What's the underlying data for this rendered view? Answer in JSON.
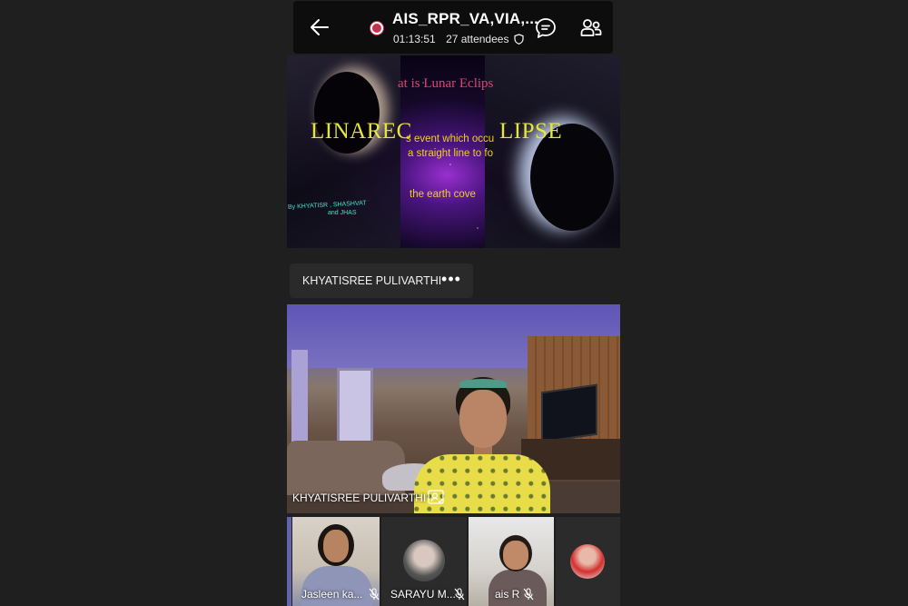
{
  "meeting": {
    "title": "AIS_RPR_VA,VIA,...",
    "duration": "01:13:51",
    "attendees": "27 attendees",
    "recording": true
  },
  "icons": {
    "back": "arrow-left-icon",
    "recording": "record-dot-icon",
    "shield": "shield-icon",
    "chat": "chat-icon",
    "participants": "people-icon",
    "more": "more-icon",
    "pin": "pin-icon",
    "mute": "mic-off-icon"
  },
  "shared_slide": {
    "title": "at is Lunar Eclips",
    "word_left": "LINAREC",
    "word_right": "LIPSE",
    "line1": "s event which occu",
    "line2": "a straight line to fo",
    "line3": "the earth cove",
    "byline": "By KHYATISR , SHASHVAT",
    "byline2": "and JHAS"
  },
  "presenter": {
    "name": "KHYATISREE PULIVARTHI",
    "more_label": "•••"
  },
  "main_video": {
    "name": "KHYATISREE PULIVARTHI"
  },
  "participants": [
    {
      "name": "Jasleen ka...",
      "muted": true
    },
    {
      "name": "SARAYU M...",
      "muted": true
    },
    {
      "name": "ais R",
      "muted": true
    },
    {
      "name": "",
      "muted": false
    }
  ],
  "colors": {
    "recording": "#c4314b",
    "accent": "#6264a7",
    "background": "#1f1f1f",
    "slide_title": "#e0407a",
    "slide_word": "#e6e63a"
  }
}
